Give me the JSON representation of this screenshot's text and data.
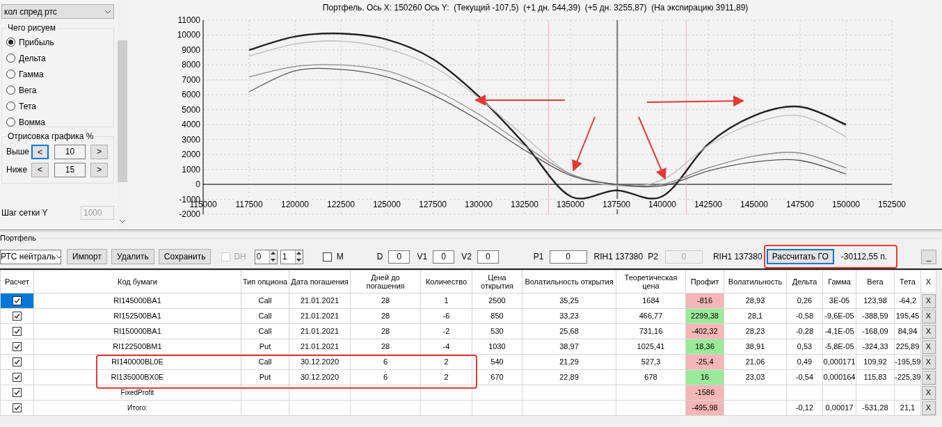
{
  "sidebar": {
    "dropdown": "кол спред ртс",
    "draw_group": {
      "title": "Чего рисуем",
      "options": [
        {
          "label": "Прибыль",
          "selected": true
        },
        {
          "label": "Дельта",
          "selected": false
        },
        {
          "label": "Гамма",
          "selected": false
        },
        {
          "label": "Вега",
          "selected": false
        },
        {
          "label": "Тета",
          "selected": false
        },
        {
          "label": "Вомма",
          "selected": false
        }
      ]
    },
    "range_group": {
      "title": "Отрисовка графика %",
      "rows": [
        {
          "label": "Выше",
          "dec": "<",
          "value": "10",
          "inc": ">",
          "focused": true
        },
        {
          "label": "Ниже",
          "dec": "<",
          "value": "15",
          "inc": ">",
          "focused": false
        }
      ]
    },
    "grid_step": {
      "label": "Шаг сетки Y",
      "value": "1000",
      "disabled": true
    }
  },
  "chart": {
    "title": "Портфель. Ось X: 150260 Ось Y:  (Текущий -107,5)  (+1 дн. 544,39)  (+5 дн. 3255,87)  (На экспирацию 3911,89)",
    "chart_data": {
      "type": "line",
      "x": [
        117500,
        120000,
        122500,
        125000,
        127500,
        130000,
        132500,
        135000,
        137500,
        140000,
        142500,
        145000,
        147500,
        150000
      ],
      "series": [
        {
          "color": "#222222",
          "values": [
            9000,
            9900,
            10100,
            9700,
            8400,
            5900,
            2700,
            -800,
            -400,
            -800,
            2700,
            4600,
            5200,
            4000
          ]
        },
        {
          "color": "#bdbdbd",
          "values": [
            8600,
            9400,
            9600,
            9100,
            7900,
            5800,
            3200,
            700,
            -100,
            300,
            2600,
            4100,
            4600,
            3200
          ]
        },
        {
          "color": "#8a8a8a",
          "values": [
            7200,
            7900,
            8000,
            7600,
            6400,
            4700,
            2600,
            700,
            0,
            0,
            1100,
            1900,
            2100,
            1100
          ]
        },
        {
          "color": "#555555",
          "values": [
            6200,
            7600,
            7700,
            7200,
            6000,
            4300,
            2300,
            600,
            0,
            -100,
            900,
            1500,
            1600,
            700
          ]
        }
      ],
      "xlim": [
        115000,
        152500
      ],
      "ylim": [
        -2000,
        11000
      ],
      "xticks": [
        115000,
        117500,
        120000,
        122500,
        125000,
        127500,
        130000,
        132500,
        135000,
        137500,
        140000,
        142500,
        145000,
        147500,
        150000,
        152500
      ],
      "yticks": [
        -2000,
        -1000,
        0,
        1000,
        2000,
        3000,
        4000,
        5000,
        6000,
        7000,
        8000,
        9000,
        10000,
        11000
      ],
      "grid": true,
      "ref_lines": [
        {
          "axis": "x",
          "value": 133800,
          "color": "#ffaaaa"
        },
        {
          "axis": "x",
          "value": 137550,
          "color": "#777777"
        },
        {
          "axis": "x",
          "value": 141300,
          "color": "#ffaaaa"
        }
      ]
    }
  },
  "portfolio": {
    "title": "Портфель",
    "toolbar": {
      "portfolio_select": "РТС нейтраль",
      "buttons": [
        "Импорт",
        "Удалить",
        "Сохранить"
      ],
      "dh": {
        "label": "DH",
        "checked": false,
        "disabled": true
      },
      "spinners": [
        "0",
        "1"
      ],
      "m": {
        "label": "M",
        "checked": false
      },
      "fields": [
        {
          "label": "D",
          "value": "0",
          "disabled": false
        },
        {
          "label": "V1",
          "value": "0",
          "disabled": false
        },
        {
          "label": "V2",
          "value": "0",
          "disabled": false
        },
        {
          "label": "P1",
          "value": "0",
          "disabled": false
        }
      ],
      "p1_ticker": "RIH1 137380",
      "p2": {
        "label": "P2",
        "value": "0",
        "disabled": true
      },
      "p2_ticker": "RIH1 137380",
      "calc_button": "Рассчитать ГО",
      "margin": "-30112,55 п.",
      "minimize": "_"
    },
    "table": {
      "columns": [
        "Расчет",
        "Код бумаги",
        "Тип опциона",
        "Дата погашения",
        "Дней до\nпогашения",
        "Количество",
        "Цена открытия",
        "Волатильность открытия",
        "Теоретическая цена",
        "Профит",
        "Волатильность",
        "Дельта",
        "Гамма",
        "Вега",
        "Тета",
        "X"
      ],
      "rows": [
        {
          "selected": true,
          "cells": [
            {
              "kind": "check",
              "checked": true
            },
            "RI145000BA1",
            "Call",
            "21.01.2021",
            "28",
            "1",
            "2500",
            "35,25",
            "1684",
            {
              "kind": "colored",
              "text": "-816",
              "color": "#f4b6b6"
            },
            "28,93",
            "0,26",
            "3E-05",
            "123,98",
            "-64,2",
            {
              "kind": "delete",
              "text": "X"
            }
          ]
        },
        {
          "selected": false,
          "cells": [
            {
              "kind": "check",
              "checked": true
            },
            "RI152500BA1",
            "Call",
            "21.01.2021",
            "28",
            "-6",
            "850",
            "33,23",
            "466,77",
            {
              "kind": "colored",
              "text": "2299,38",
              "color": "#9aea9a"
            },
            "28,1",
            "-0,58",
            "-9,6E-05",
            "-388,59",
            "195,45",
            {
              "kind": "delete",
              "text": "X"
            }
          ]
        },
        {
          "selected": false,
          "cells": [
            {
              "kind": "check",
              "checked": true
            },
            "RI150000BA1",
            "Call",
            "21.01.2021",
            "28",
            "-2",
            "530",
            "25,68",
            "731,16",
            {
              "kind": "colored",
              "text": "-402,32",
              "color": "#f4b6b6"
            },
            "28,23",
            "-0,28",
            "-4,1E-05",
            "-168,09",
            "84,94",
            {
              "kind": "delete",
              "text": "X"
            }
          ]
        },
        {
          "selected": false,
          "cells": [
            {
              "kind": "check",
              "checked": true
            },
            "RI122500BM1",
            "Put",
            "21.01.2021",
            "28",
            "-4",
            "1030",
            "38,97",
            "1025,41",
            {
              "kind": "colored",
              "text": "18,36",
              "color": "#9aea9a"
            },
            "38,91",
            "0,53",
            "-5,8E-05",
            "-324,33",
            "225,89",
            {
              "kind": "delete",
              "text": "X"
            }
          ]
        },
        {
          "selected": false,
          "cells": [
            {
              "kind": "check",
              "checked": true
            },
            "RI140000BL0E",
            "Call",
            "30.12.2020",
            "6",
            "2",
            "540",
            "21,29",
            "527,3",
            {
              "kind": "colored",
              "text": "-25,4",
              "color": "#f4b6b6"
            },
            "21,06",
            "0,49",
            "0,000171",
            "109,92",
            "-195,59",
            {
              "kind": "delete",
              "text": "X"
            }
          ]
        },
        {
          "selected": false,
          "cells": [
            {
              "kind": "check",
              "checked": true
            },
            "RI135000BX0E",
            "Put",
            "30.12.2020",
            "6",
            "2",
            "670",
            "22,89",
            "678",
            {
              "kind": "colored",
              "text": "16",
              "color": "#9aea9a"
            },
            "23,03",
            "-0,54",
            "0,000164",
            "115,83",
            "-225,39",
            {
              "kind": "delete",
              "text": "X"
            }
          ]
        },
        {
          "selected": false,
          "cells": [
            {
              "kind": "check",
              "checked": true
            },
            "FixedProfit",
            null,
            null,
            null,
            null,
            null,
            null,
            null,
            {
              "kind": "colored",
              "text": "-1586",
              "color": "#f4b6b6"
            },
            null,
            null,
            null,
            null,
            null,
            {
              "kind": "delete",
              "text": "X"
            }
          ]
        },
        {
          "selected": false,
          "cells": [
            {
              "kind": "check",
              "checked": true
            },
            "Итого:",
            null,
            null,
            null,
            null,
            null,
            null,
            null,
            {
              "kind": "colored",
              "text": "-495,98",
              "color": "#f4b6b6"
            },
            null,
            "-0,12",
            "0,00017",
            "-531,28",
            "21,1",
            {
              "kind": "delete",
              "text": "X"
            }
          ]
        }
      ]
    }
  }
}
